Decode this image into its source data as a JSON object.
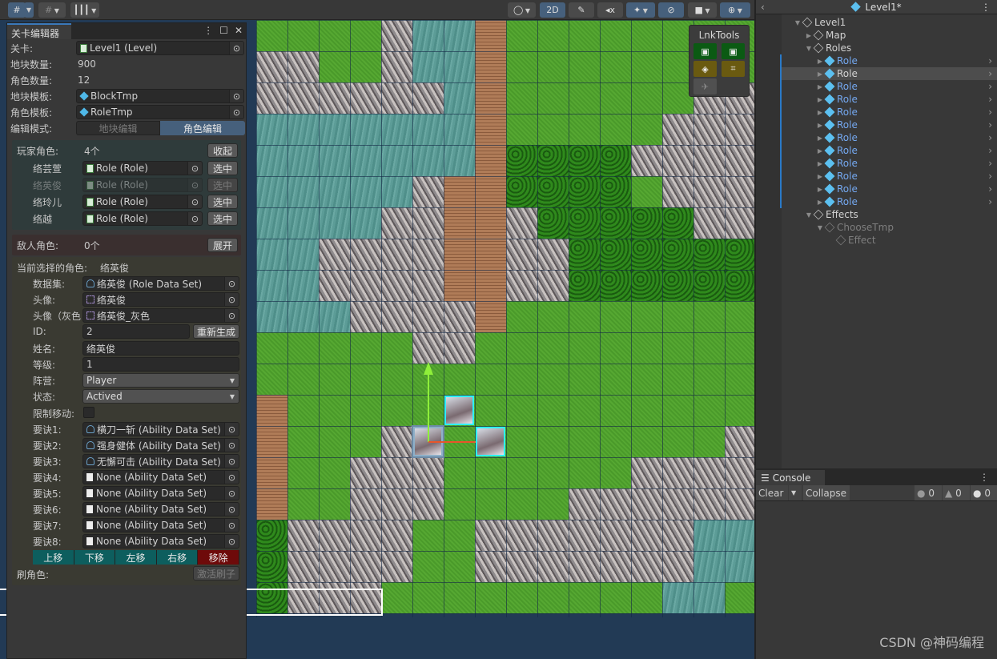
{
  "scene_toolbar": {
    "left_tools": [
      {
        "icon": "grid-snap-icon",
        "active": true
      },
      {
        "icon": "increment-snap-icon",
        "active": false
      },
      {
        "icon": "ruler-icon",
        "active": false
      }
    ],
    "right_tools": [
      {
        "icon": "shading-mode-icon"
      },
      {
        "label": "2D",
        "active": true
      },
      {
        "icon": "lighting-icon"
      },
      {
        "icon": "audio-mute-icon"
      },
      {
        "icon": "effects-icon",
        "active": true
      },
      {
        "icon": "visibility-icon",
        "active": true
      },
      {
        "icon": "camera-icon"
      },
      {
        "icon": "gizmos-icon",
        "active": true
      }
    ]
  },
  "lnktools": {
    "title": "LnkTools",
    "buttons": [
      {
        "icon": "save-icon",
        "color": "#0b5a13"
      },
      {
        "icon": "save-as-icon",
        "color": "#0b5a13"
      },
      {
        "icon": "block-brush-icon",
        "color": "#6a5a10"
      },
      {
        "icon": "select-rect-icon",
        "color": "#6a5a10"
      },
      {
        "icon": "pin-icon",
        "disabled": true
      }
    ]
  },
  "map": {
    "columns": 16,
    "legend": {
      "g": "grass",
      "w": "water",
      "s": "stone",
      "f": "forest",
      "b": "bridge"
    },
    "rows": [
      "ggggswwbgggggggg",
      "ssggswwbgggggggg",
      "sssssswbggggggss",
      "wwwwwwwbgggggsss",
      "wwwwwwwbffffssss",
      "wwwwwsbbffffgsss",
      "wwwwssbbsfffffss",
      "wwssssbbssffffff",
      "wwssssbbssffffff",
      "wwwssssbgggggggg",
      "gggggssggggggggg",
      "gggggggggggggggg",
      "bggggggggggggggg",
      "bgggsggggggggggs",
      "bggsssggggggssss",
      "bggsssggggssssss",
      "fssssggsssssssww",
      "fssssggsssssssww",
      "fsssgggggggggwwg"
    ],
    "roles": [
      {
        "name": "络芸萱",
        "col": 6,
        "row": 12
      },
      {
        "name": "络英俊",
        "col": 5,
        "row": 13,
        "selected": true
      },
      {
        "name": "络玲儿",
        "col": 7,
        "row": 13
      }
    ]
  },
  "editor": {
    "tab_title": "关卡编辑器",
    "level_label": "关卡:",
    "level_value": "Level1 (Level)",
    "block_count_label": "地块数量:",
    "block_count": "900",
    "role_count_label": "角色数量:",
    "role_count": "12",
    "block_template_label": "地块模板:",
    "block_template": "BlockTmp",
    "role_template_label": "角色模板:",
    "role_template": "RoleTmp",
    "edit_mode_label": "编辑模式:",
    "edit_modes": [
      "地块编辑",
      "角色编辑"
    ],
    "edit_mode_active": 1,
    "players": {
      "label": "玩家角色:",
      "count": "4个",
      "toggle": "收起",
      "items": [
        {
          "name": "络芸萱",
          "ref": "Role (Role)",
          "select": "选中",
          "disabled": false
        },
        {
          "name": "络英俊",
          "ref": "Role (Role)",
          "select": "选中",
          "disabled": true
        },
        {
          "name": "络玲儿",
          "ref": "Role (Role)",
          "select": "选中",
          "disabled": false
        },
        {
          "name": "络越",
          "ref": "Role (Role)",
          "select": "选中",
          "disabled": false
        }
      ]
    },
    "enemies": {
      "label": "敌人角色:",
      "count": "0个",
      "toggle": "展开"
    },
    "selected": {
      "label": "当前选择的角色:",
      "name": "络英俊",
      "dataset_label": "数据集:",
      "dataset": "络英俊 (Role Data Set)",
      "avatar_label": "头像:",
      "avatar": "络英俊",
      "avatar_gray_label": "头像（灰色",
      "avatar_gray": "络英俊_灰色",
      "id_label": "ID:",
      "id": "2",
      "regenerate": "重新生成",
      "name_label": "姓名:",
      "name_value": "络英俊",
      "level_label": "等级:",
      "level": "1",
      "camp_label": "阵营:",
      "camp": "Player",
      "state_label": "状态:",
      "state": "Actived",
      "restrict_move_label": "限制移动:",
      "restrict_move": false,
      "abilities": [
        {
          "label": "要诀1:",
          "value": "横刀一斩 (Ability Data Set)",
          "set": true
        },
        {
          "label": "要诀2:",
          "value": "强身健体 (Ability Data Set)",
          "set": true
        },
        {
          "label": "要诀3:",
          "value": "无懈可击 (Ability Data Set)",
          "set": true
        },
        {
          "label": "要诀4:",
          "value": "None (Ability Data Set)",
          "set": false
        },
        {
          "label": "要诀5:",
          "value": "None (Ability Data Set)",
          "set": false
        },
        {
          "label": "要诀6:",
          "value": "None (Ability Data Set)",
          "set": false
        },
        {
          "label": "要诀7:",
          "value": "None (Ability Data Set)",
          "set": false
        },
        {
          "label": "要诀8:",
          "value": "None (Ability Data Set)",
          "set": false
        }
      ],
      "move_buttons": [
        "上移",
        "下移",
        "左移",
        "右移"
      ],
      "remove": "移除",
      "remove_color": "#6e0a0a",
      "move_color": "#0d5e5e"
    },
    "brush_label": "刷角色:",
    "brush_button": "激活刷子"
  },
  "hierarchy": {
    "title": "Level1*",
    "items": [
      {
        "label": "Level1",
        "depth": 0,
        "arrow": "down",
        "type": "go"
      },
      {
        "label": "Map",
        "depth": 1,
        "arrow": "right",
        "type": "go"
      },
      {
        "label": "Roles",
        "depth": 1,
        "arrow": "down",
        "type": "go"
      },
      {
        "label": "Role",
        "depth": 2,
        "arrow": "right",
        "type": "prefab"
      },
      {
        "label": "Role",
        "depth": 2,
        "arrow": "right",
        "type": "prefab",
        "selected": true
      },
      {
        "label": "Role",
        "depth": 2,
        "arrow": "right",
        "type": "prefab"
      },
      {
        "label": "Role",
        "depth": 2,
        "arrow": "right",
        "type": "prefab"
      },
      {
        "label": "Role",
        "depth": 2,
        "arrow": "right",
        "type": "prefab"
      },
      {
        "label": "Role",
        "depth": 2,
        "arrow": "right",
        "type": "prefab"
      },
      {
        "label": "Role",
        "depth": 2,
        "arrow": "right",
        "type": "prefab"
      },
      {
        "label": "Role",
        "depth": 2,
        "arrow": "right",
        "type": "prefab"
      },
      {
        "label": "Role",
        "depth": 2,
        "arrow": "right",
        "type": "prefab"
      },
      {
        "label": "Role",
        "depth": 2,
        "arrow": "right",
        "type": "prefab"
      },
      {
        "label": "Role",
        "depth": 2,
        "arrow": "right",
        "type": "prefab"
      },
      {
        "label": "Role",
        "depth": 2,
        "arrow": "right",
        "type": "prefab"
      },
      {
        "label": "Effects",
        "depth": 1,
        "arrow": "down",
        "type": "go"
      },
      {
        "label": "ChooseTmp",
        "depth": 2,
        "arrow": "down",
        "type": "go",
        "inactive": true
      },
      {
        "label": "Effect",
        "depth": 3,
        "arrow": "",
        "type": "go",
        "inactive": true
      }
    ]
  },
  "console": {
    "tab_title": "Console",
    "clear": "Clear",
    "collapse": "Collapse",
    "info_count": "0",
    "warning_count": "0",
    "error_count": "0"
  },
  "watermark": "CSDN @神码编程"
}
